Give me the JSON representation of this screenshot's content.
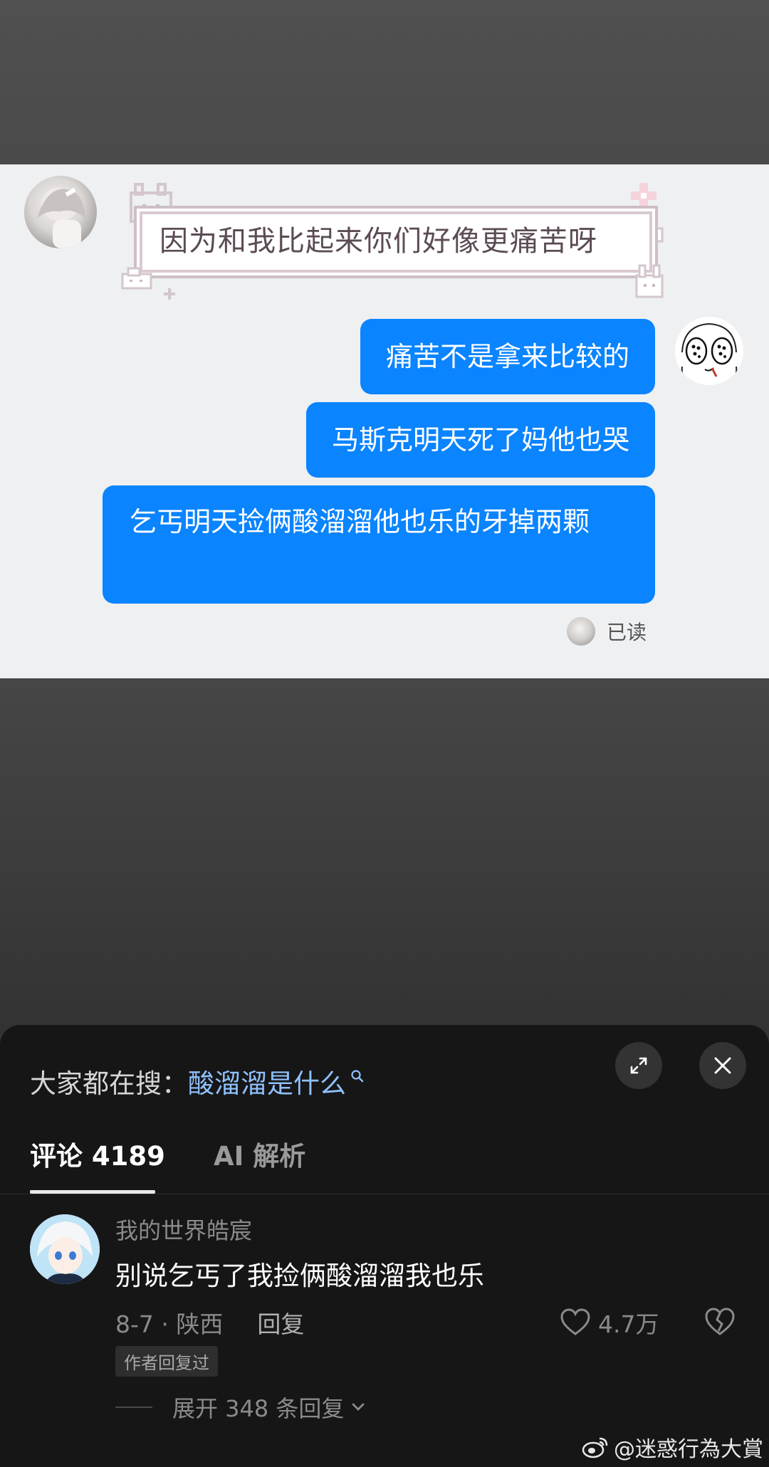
{
  "chat": {
    "incoming_message": "因为和我比起来你们好像更痛苦呀",
    "outgoing_messages": [
      "痛苦不是拿来比较的",
      "马斯克明天死了妈他也哭",
      "乞丐明天捡俩酸溜溜他也乐的牙掉两颗"
    ],
    "read_status": "已读",
    "bubble_color": "#0a84ff"
  },
  "sheet": {
    "search_prefix": "大家都在搜：",
    "search_term": "酸溜溜是什么",
    "icons": {
      "search": "search-icon",
      "expand": "expand-icon",
      "close": "close-icon"
    },
    "tabs": {
      "comments_label": "评论",
      "comments_count": "4189",
      "ai_label": "AI 解析"
    },
    "comment": {
      "username": "我的世界皓宸",
      "text": "别说乞丐了我捡俩酸溜溜我也乐",
      "date_location": "8-7 · 陕西",
      "reply_label": "回复",
      "likes": "4.7万",
      "author_badge": "作者回复过",
      "expand_replies": "展开 348 条回复"
    }
  },
  "watermark": "@迷惑行為大賞"
}
